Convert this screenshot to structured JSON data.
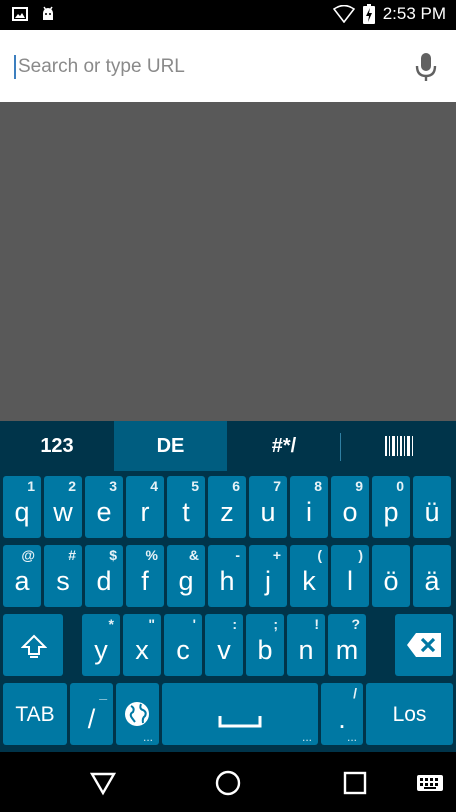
{
  "status": {
    "time": "2:53 PM"
  },
  "urlbar": {
    "placeholder": "Search or type URL"
  },
  "keyboard": {
    "tabs": [
      {
        "label": "123",
        "active": false
      },
      {
        "label": "DE",
        "active": true
      },
      {
        "label": "#*/",
        "active": false
      },
      {
        "label": "",
        "icon": "barcode-icon",
        "active": false
      }
    ],
    "rows": [
      [
        [
          "q",
          "1"
        ],
        [
          "w",
          "2"
        ],
        [
          "e",
          "3"
        ],
        [
          "r",
          "4"
        ],
        [
          "t",
          "5"
        ],
        [
          "z",
          "6"
        ],
        [
          "u",
          "7"
        ],
        [
          "i",
          "8"
        ],
        [
          "o",
          "9"
        ],
        [
          "p",
          "0"
        ],
        [
          "ü",
          ""
        ]
      ],
      [
        [
          "a",
          "@"
        ],
        [
          "s",
          "#"
        ],
        [
          "d",
          "$"
        ],
        [
          "f",
          "%"
        ],
        [
          "g",
          "&"
        ],
        [
          "h",
          "-"
        ],
        [
          "j",
          "+"
        ],
        [
          "k",
          "("
        ],
        [
          "l",
          ")"
        ],
        [
          "ö",
          ""
        ],
        [
          "ä",
          ""
        ]
      ],
      [
        [
          "y",
          "*"
        ],
        [
          "x",
          "\""
        ],
        [
          "c",
          "'"
        ],
        [
          "v",
          ":"
        ],
        [
          "b",
          ";"
        ],
        [
          "n",
          "!"
        ],
        [
          "m",
          "?"
        ]
      ]
    ],
    "bottom": {
      "tab_label": "TAB",
      "slash_label": "/",
      "slash_alt": "_",
      "dot_label": ".",
      "dot_alt": "/",
      "go_label": "Los"
    },
    "colors": {
      "key": "#0078a3",
      "background": "#00344a",
      "active_tab": "#005d80"
    }
  }
}
